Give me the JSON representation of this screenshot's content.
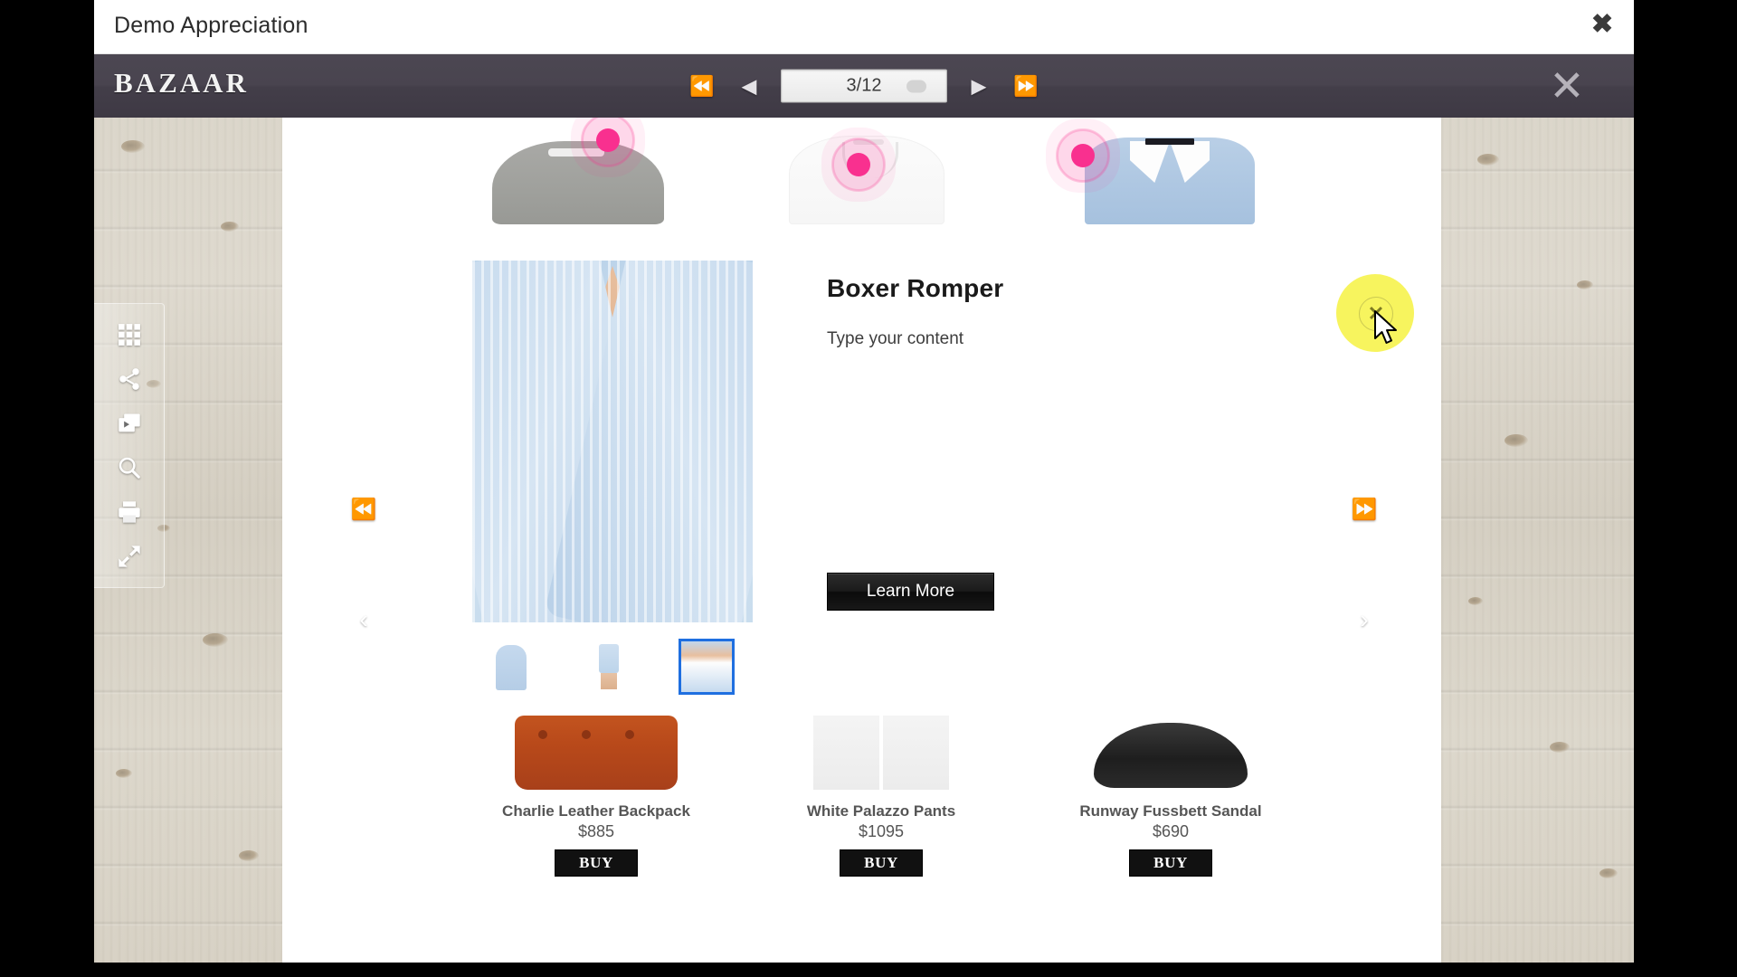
{
  "window": {
    "title": "Demo Appreciation",
    "close_label": "✖"
  },
  "viewer_toolbar": {
    "brand": "BAZAAR",
    "first_page_label": "⏪",
    "prev_page_label": "◀",
    "next_page_label": "▶",
    "last_page_label": "⏩",
    "page_indicator": "3/12",
    "current_page": 3,
    "total_pages": 12,
    "close_label": "✕"
  },
  "tool_rail": {
    "items": [
      {
        "name": "thumbnails-icon",
        "label": "Thumbnails"
      },
      {
        "name": "share-icon",
        "label": "Share"
      },
      {
        "name": "slideshow-icon",
        "label": "Slideshow"
      },
      {
        "name": "zoom-icon",
        "label": "Zoom"
      },
      {
        "name": "print-icon",
        "label": "Print"
      },
      {
        "name": "fullscreen-icon",
        "label": "Fullscreen"
      }
    ]
  },
  "side_nav": {
    "first_label": "⏪",
    "prev_label": "‹",
    "last_label": "⏩",
    "next_label": "›"
  },
  "hero": {
    "items": [
      {
        "name": "grey-sweatshirt",
        "hotspot": true
      },
      {
        "name": "white-shirt",
        "hotspot": true
      },
      {
        "name": "blue-oxford-shirt",
        "hotspot": true
      }
    ]
  },
  "product": {
    "title": "Boxer Romper",
    "description": "Type your content",
    "learn_more_label": "Learn More",
    "thumbnails": [
      {
        "name": "thumb-shirtdress",
        "selected": false
      },
      {
        "name": "thumb-legs",
        "selected": false
      },
      {
        "name": "thumb-boxer-detail",
        "selected": true
      }
    ]
  },
  "shop_row": {
    "buy_label": "BUY",
    "products": [
      {
        "name": "Charlie Leather Backpack",
        "price": "$885"
      },
      {
        "name": "White Palazzo Pants",
        "price": "$1095"
      },
      {
        "name": "Runway Fussbett Sandal",
        "price": "$690"
      }
    ]
  },
  "overlay": {
    "close_hotspot_label": "✕"
  },
  "colors": {
    "hotspot_pink": "#f9308f",
    "click_highlight_yellow": "#f7f45e",
    "selected_thumb_blue": "#1f6fe0",
    "toolbar_dark": "#49444f",
    "wood_beige": "#d9d4c8"
  }
}
